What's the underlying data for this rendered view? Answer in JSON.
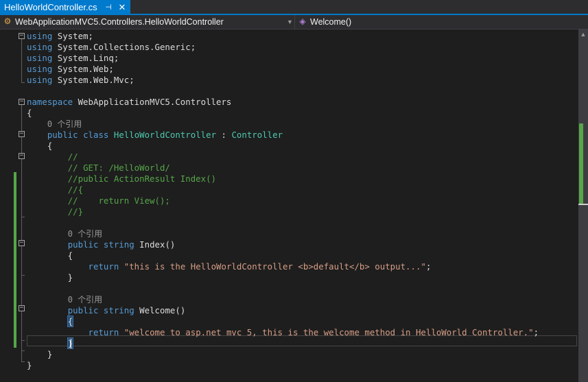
{
  "tab": {
    "title": "HelloWorldController.cs",
    "pin_icon": "pin-icon",
    "close_icon": "close-icon"
  },
  "navbar": {
    "project": "WebApplicationMVC5.Controllers.HelloWorldController",
    "member": "Welcome()",
    "project_icon": "csharp-project-icon",
    "member_icon": "method-icon"
  },
  "code_lines": [
    "using System;",
    "using System.Collections.Generic;",
    "using System.Linq;",
    "using System.Web;",
    "using System.Web.Mvc;",
    "",
    "namespace WebApplicationMVC5.Controllers",
    "{",
    "    0 个引用",
    "    public class HelloWorldController : Controller",
    "    {",
    "        //",
    "        // GET: /HelloWorld/",
    "        //public ActionResult Index()",
    "        //{",
    "        //    return View();",
    "        //}",
    "",
    "        0 个引用",
    "        public string Index()",
    "        {",
    "            return \"this is the HelloWorldController <b>default</b> output...\";",
    "        }",
    "",
    "        0 个引用",
    "        public string Welcome()",
    "        {",
    "            return \"welcome to asp.net mvc 5, this is the welcome method in HelloWorld Controller.\";",
    "        }",
    "    }",
    "}"
  ],
  "colors": {
    "keyword": "#569cd6",
    "type": "#4ec9b0",
    "comment": "#57a64a",
    "string": "#d69d85",
    "text": "#dcdcdc",
    "accent": "#007acc"
  }
}
